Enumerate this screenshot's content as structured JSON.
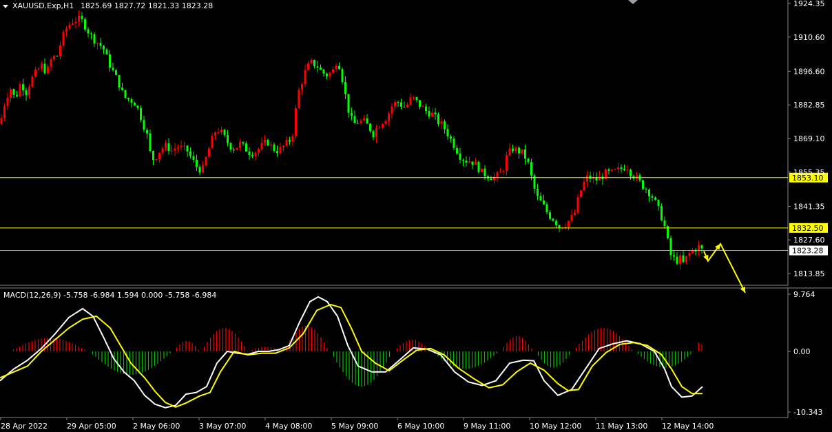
{
  "header": {
    "symbol": "XAUUSD.Exp,H1",
    "ohlc": "1825.69 1827.72 1821.33 1823.28"
  },
  "indicator": {
    "label": "MACD(12,26,9) -5.758 -6.984 1.594 0.000 -5.758 -6.984"
  },
  "colors": {
    "background": "#000000",
    "bull": "#ff0000",
    "bear": "#00ff00",
    "level_line": "#ffff00",
    "price_line": "#ffffff",
    "macd_line": "#ffffff",
    "signal_line": "#ffff00",
    "hist_pos": "#ff0000",
    "hist_neg": "#00c000",
    "arrow": "#ffff00"
  },
  "chart_data": [
    {
      "type": "candlestick",
      "title": "XAUUSD.Exp,H1",
      "ylim": [
        1807,
        1925
      ],
      "y_ticks": [
        "1924.35",
        "1910.60",
        "1896.60",
        "1882.85",
        "1869.10",
        "1855.35",
        "1841.35",
        "1827.60",
        "1813.85"
      ],
      "x_labels": [
        "28 Apr 2022",
        "29 Apr 05:00",
        "2 May 06:00",
        "3 May 07:00",
        "4 May 08:00",
        "5 May 09:00",
        "6 May 10:00",
        "9 May 11:00",
        "10 May 12:00",
        "11 May 13:00",
        "12 May 14:00"
      ],
      "levels": [
        {
          "value": 1853.1,
          "label": "1853.10"
        },
        {
          "value": 1832.5,
          "label": "1832.50"
        }
      ],
      "current_price": {
        "value": 1823.28,
        "label": "1823.28"
      },
      "close_path": [
        [
          0,
          1875
        ],
        [
          8,
          1885
        ],
        [
          15,
          1890
        ],
        [
          22,
          1885
        ],
        [
          30,
          1892
        ],
        [
          38,
          1888
        ],
        [
          45,
          1893
        ],
        [
          52,
          1896
        ],
        [
          60,
          1899
        ],
        [
          68,
          1896
        ],
        [
          75,
          1902
        ],
        [
          83,
          1903
        ],
        [
          90,
          1910
        ],
        [
          98,
          1915
        ],
        [
          105,
          1917
        ],
        [
          113,
          1918
        ],
        [
          120,
          1917
        ],
        [
          128,
          1913
        ],
        [
          135,
          1910
        ],
        [
          143,
          1908
        ],
        [
          150,
          1906
        ],
        [
          158,
          1900
        ],
        [
          165,
          1896
        ],
        [
          172,
          1892
        ],
        [
          180,
          1886
        ],
        [
          188,
          1885
        ],
        [
          195,
          1884
        ],
        [
          202,
          1880
        ],
        [
          208,
          1875
        ],
        [
          214,
          1870
        ],
        [
          220,
          1860
        ],
        [
          227,
          1862
        ],
        [
          234,
          1865
        ],
        [
          242,
          1866
        ],
        [
          250,
          1864
        ],
        [
          257,
          1866
        ],
        [
          265,
          1865
        ],
        [
          272,
          1864
        ],
        [
          280,
          1860
        ],
        [
          287,
          1857
        ],
        [
          294,
          1856
        ],
        [
          300,
          1862
        ],
        [
          307,
          1868
        ],
        [
          314,
          1873
        ],
        [
          320,
          1872
        ],
        [
          327,
          1869
        ],
        [
          334,
          1866
        ],
        [
          341,
          1865
        ],
        [
          348,
          1867
        ],
        [
          356,
          1865
        ],
        [
          364,
          1863
        ],
        [
          372,
          1864
        ],
        [
          380,
          1866
        ],
        [
          388,
          1868
        ],
        [
          396,
          1865
        ],
        [
          404,
          1864
        ],
        [
          412,
          1866
        ],
        [
          420,
          1868
        ],
        [
          426,
          1872
        ],
        [
          432,
          1887
        ],
        [
          438,
          1892
        ],
        [
          445,
          1898
        ],
        [
          452,
          1900
        ],
        [
          460,
          1899
        ],
        [
          468,
          1896
        ],
        [
          476,
          1895
        ],
        [
          484,
          1897
        ],
        [
          490,
          1902
        ],
        [
          496,
          1895
        ],
        [
          502,
          1886
        ],
        [
          508,
          1878
        ],
        [
          514,
          1875
        ],
        [
          520,
          1876
        ],
        [
          528,
          1876
        ],
        [
          535,
          1874
        ],
        [
          542,
          1871
        ],
        [
          548,
          1874
        ],
        [
          555,
          1876
        ],
        [
          562,
          1878
        ],
        [
          570,
          1883
        ],
        [
          578,
          1884
        ],
        [
          586,
          1882
        ],
        [
          592,
          1883
        ],
        [
          598,
          1886
        ],
        [
          605,
          1884
        ],
        [
          612,
          1882
        ],
        [
          620,
          1880
        ],
        [
          628,
          1879
        ],
        [
          636,
          1876
        ],
        [
          644,
          1874
        ],
        [
          652,
          1870
        ],
        [
          660,
          1866
        ],
        [
          668,
          1862
        ],
        [
          676,
          1860
        ],
        [
          684,
          1860
        ],
        [
          692,
          1858
        ],
        [
          700,
          1855
        ],
        [
          708,
          1854
        ],
        [
          716,
          1853
        ],
        [
          724,
          1854
        ],
        [
          730,
          1856
        ],
        [
          736,
          1862
        ],
        [
          744,
          1865
        ],
        [
          752,
          1864
        ],
        [
          760,
          1863
        ],
        [
          768,
          1858
        ],
        [
          774,
          1850
        ],
        [
          780,
          1845
        ],
        [
          788,
          1842
        ],
        [
          796,
          1838
        ],
        [
          804,
          1836
        ],
        [
          812,
          1833
        ],
        [
          820,
          1834
        ],
        [
          828,
          1836
        ],
        [
          834,
          1838
        ],
        [
          840,
          1845
        ],
        [
          846,
          1850
        ],
        [
          852,
          1853
        ],
        [
          858,
          1853
        ],
        [
          864,
          1852
        ],
        [
          872,
          1853
        ],
        [
          880,
          1855
        ],
        [
          888,
          1855
        ],
        [
          896,
          1856
        ],
        [
          904,
          1857
        ],
        [
          910,
          1858
        ],
        [
          916,
          1855
        ],
        [
          924,
          1853
        ],
        [
          932,
          1850
        ],
        [
          940,
          1848
        ],
        [
          948,
          1845
        ],
        [
          956,
          1840
        ],
        [
          962,
          1836
        ],
        [
          968,
          1830
        ],
        [
          972,
          1822
        ],
        [
          978,
          1820
        ],
        [
          984,
          1819
        ],
        [
          988,
          1820
        ],
        [
          992,
          1818
        ],
        [
          998,
          1821
        ],
        [
          1004,
          1823
        ],
        [
          1010,
          1824
        ],
        [
          1016,
          1825
        ],
        [
          1020,
          1823
        ]
      ]
    },
    {
      "type": "line",
      "title": "MACD(12,26,9)",
      "ylim": [
        -10.343,
        9.764
      ],
      "y_ticks": [
        "9.764",
        "0.00",
        "-10.343"
      ],
      "series": [
        {
          "name": "MACD",
          "points": [
            [
              0,
              -5
            ],
            [
              20,
              -3
            ],
            [
              40,
              -1.5
            ],
            [
              60,
              0.5
            ],
            [
              80,
              3
            ],
            [
              100,
              5.8
            ],
            [
              120,
              7.3
            ],
            [
              135,
              6
            ],
            [
              150,
              2.5
            ],
            [
              165,
              -1.2
            ],
            [
              180,
              -3.5
            ],
            [
              195,
              -5
            ],
            [
              210,
              -7.5
            ],
            [
              225,
              -9
            ],
            [
              240,
              -9.6
            ],
            [
              255,
              -9.2
            ],
            [
              270,
              -7.3
            ],
            [
              285,
              -7
            ],
            [
              300,
              -6
            ],
            [
              315,
              -2
            ],
            [
              330,
              0
            ],
            [
              345,
              -0.3
            ],
            [
              360,
              -0.5
            ],
            [
              375,
              0
            ],
            [
              390,
              0
            ],
            [
              405,
              0.3
            ],
            [
              420,
              1
            ],
            [
              435,
              5
            ],
            [
              450,
              8.5
            ],
            [
              462,
              9.3
            ],
            [
              475,
              8.5
            ],
            [
              490,
              6
            ],
            [
              505,
              1
            ],
            [
              520,
              -2.5
            ],
            [
              540,
              -3.5
            ],
            [
              560,
              -3.5
            ],
            [
              580,
              -1.5
            ],
            [
              600,
              0.6
            ],
            [
              620,
              0.4
            ],
            [
              640,
              -0.6
            ],
            [
              660,
              -3.5
            ],
            [
              680,
              -5.2
            ],
            [
              700,
              -5.8
            ],
            [
              720,
              -5
            ],
            [
              740,
              -2
            ],
            [
              760,
              -1.5
            ],
            [
              775,
              -1.6
            ],
            [
              790,
              -5
            ],
            [
              810,
              -7.5
            ],
            [
              830,
              -6.5
            ],
            [
              850,
              -3
            ],
            [
              870,
              0.5
            ],
            [
              890,
              1.3
            ],
            [
              910,
              1.8
            ],
            [
              930,
              1.3
            ],
            [
              950,
              0
            ],
            [
              965,
              -3
            ],
            [
              975,
              -6
            ],
            [
              990,
              -7.8
            ],
            [
              1005,
              -7.6
            ],
            [
              1020,
              -6
            ]
          ]
        },
        {
          "name": "Signal",
          "points": [
            [
              0,
              -4.5
            ],
            [
              20,
              -3.5
            ],
            [
              40,
              -2.5
            ],
            [
              60,
              0
            ],
            [
              80,
              2
            ],
            [
              100,
              4
            ],
            [
              120,
              5.5
            ],
            [
              140,
              6
            ],
            [
              160,
              4
            ],
            [
              175,
              1
            ],
            [
              190,
              -2
            ],
            [
              210,
              -4.5
            ],
            [
              225,
              -6.8
            ],
            [
              240,
              -8.7
            ],
            [
              255,
              -9.5
            ],
            [
              270,
              -8.8
            ],
            [
              290,
              -7.6
            ],
            [
              305,
              -7
            ],
            [
              320,
              -3.5
            ],
            [
              340,
              0
            ],
            [
              360,
              -0.6
            ],
            [
              380,
              -0.3
            ],
            [
              400,
              -0.3
            ],
            [
              420,
              0.6
            ],
            [
              440,
              3
            ],
            [
              460,
              7
            ],
            [
              480,
              8
            ],
            [
              495,
              7.5
            ],
            [
              510,
              4
            ],
            [
              525,
              0
            ],
            [
              545,
              -2
            ],
            [
              565,
              -3.3
            ],
            [
              585,
              -1.5
            ],
            [
              605,
              0.2
            ],
            [
              625,
              0.5
            ],
            [
              645,
              -0.6
            ],
            [
              665,
              -2.8
            ],
            [
              690,
              -4.8
            ],
            [
              710,
              -6.2
            ],
            [
              730,
              -5.7
            ],
            [
              750,
              -3.5
            ],
            [
              770,
              -2
            ],
            [
              790,
              -3.2
            ],
            [
              810,
              -5.5
            ],
            [
              825,
              -6.7
            ],
            [
              840,
              -6.5
            ],
            [
              860,
              -2.5
            ],
            [
              880,
              -0.2
            ],
            [
              900,
              1.2
            ],
            [
              920,
              1.5
            ],
            [
              940,
              1
            ],
            [
              960,
              -0.5
            ],
            [
              975,
              -3
            ],
            [
              990,
              -6
            ],
            [
              1005,
              -7.2
            ],
            [
              1020,
              -7.2
            ]
          ]
        }
      ],
      "histogram_ranges": [
        {
          "x0": 15,
          "x1": 128,
          "peak": 2.3,
          "sign": "pos"
        },
        {
          "x0": 130,
          "x1": 250,
          "peak": -4.0,
          "sign": "neg"
        },
        {
          "x0": 252,
          "x1": 290,
          "peak": 1.8,
          "sign": "pos"
        },
        {
          "x0": 292,
          "x1": 360,
          "peak": 4.0,
          "sign": "pos"
        },
        {
          "x0": 362,
          "x1": 410,
          "peak": 0.8,
          "sign": "pos"
        },
        {
          "x0": 412,
          "x1": 478,
          "peak": 4.4,
          "sign": "pos"
        },
        {
          "x0": 480,
          "x1": 570,
          "peak": -6.0,
          "sign": "neg"
        },
        {
          "x0": 572,
          "x1": 625,
          "peak": 2.0,
          "sign": "pos"
        },
        {
          "x0": 627,
          "x1": 725,
          "peak": -3.0,
          "sign": "neg"
        },
        {
          "x0": 727,
          "x1": 775,
          "peak": 2.6,
          "sign": "pos"
        },
        {
          "x0": 777,
          "x1": 830,
          "peak": -2.8,
          "sign": "neg"
        },
        {
          "x0": 832,
          "x1": 920,
          "peak": 4.0,
          "sign": "pos"
        },
        {
          "x0": 922,
          "x1": 1008,
          "peak": -2.8,
          "sign": "neg"
        },
        {
          "x0": 1010,
          "x1": 1022,
          "peak": 1.6,
          "sign": "pos"
        }
      ]
    }
  ],
  "forecast_arrow": [
    [
      1022,
      1823
    ],
    [
      1028,
      1819
    ],
    [
      1046,
      1826
    ],
    [
      1082,
      1806
    ]
  ]
}
